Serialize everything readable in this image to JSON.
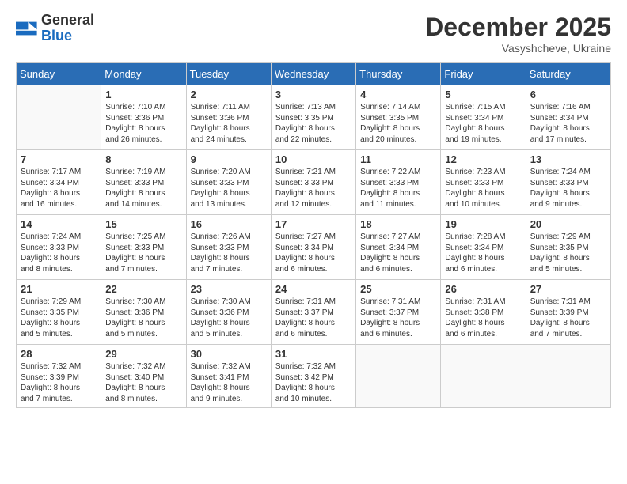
{
  "logo": {
    "general": "General",
    "blue": "Blue"
  },
  "header": {
    "month": "December 2025",
    "location": "Vasyshcheve, Ukraine"
  },
  "weekdays": [
    "Sunday",
    "Monday",
    "Tuesday",
    "Wednesday",
    "Thursday",
    "Friday",
    "Saturday"
  ],
  "weeks": [
    [
      {
        "day": "",
        "lines": []
      },
      {
        "day": "1",
        "lines": [
          "Sunrise: 7:10 AM",
          "Sunset: 3:36 PM",
          "Daylight: 8 hours",
          "and 26 minutes."
        ]
      },
      {
        "day": "2",
        "lines": [
          "Sunrise: 7:11 AM",
          "Sunset: 3:36 PM",
          "Daylight: 8 hours",
          "and 24 minutes."
        ]
      },
      {
        "day": "3",
        "lines": [
          "Sunrise: 7:13 AM",
          "Sunset: 3:35 PM",
          "Daylight: 8 hours",
          "and 22 minutes."
        ]
      },
      {
        "day": "4",
        "lines": [
          "Sunrise: 7:14 AM",
          "Sunset: 3:35 PM",
          "Daylight: 8 hours",
          "and 20 minutes."
        ]
      },
      {
        "day": "5",
        "lines": [
          "Sunrise: 7:15 AM",
          "Sunset: 3:34 PM",
          "Daylight: 8 hours",
          "and 19 minutes."
        ]
      },
      {
        "day": "6",
        "lines": [
          "Sunrise: 7:16 AM",
          "Sunset: 3:34 PM",
          "Daylight: 8 hours",
          "and 17 minutes."
        ]
      }
    ],
    [
      {
        "day": "7",
        "lines": [
          "Sunrise: 7:17 AM",
          "Sunset: 3:34 PM",
          "Daylight: 8 hours",
          "and 16 minutes."
        ]
      },
      {
        "day": "8",
        "lines": [
          "Sunrise: 7:19 AM",
          "Sunset: 3:33 PM",
          "Daylight: 8 hours",
          "and 14 minutes."
        ]
      },
      {
        "day": "9",
        "lines": [
          "Sunrise: 7:20 AM",
          "Sunset: 3:33 PM",
          "Daylight: 8 hours",
          "and 13 minutes."
        ]
      },
      {
        "day": "10",
        "lines": [
          "Sunrise: 7:21 AM",
          "Sunset: 3:33 PM",
          "Daylight: 8 hours",
          "and 12 minutes."
        ]
      },
      {
        "day": "11",
        "lines": [
          "Sunrise: 7:22 AM",
          "Sunset: 3:33 PM",
          "Daylight: 8 hours",
          "and 11 minutes."
        ]
      },
      {
        "day": "12",
        "lines": [
          "Sunrise: 7:23 AM",
          "Sunset: 3:33 PM",
          "Daylight: 8 hours",
          "and 10 minutes."
        ]
      },
      {
        "day": "13",
        "lines": [
          "Sunrise: 7:24 AM",
          "Sunset: 3:33 PM",
          "Daylight: 8 hours",
          "and 9 minutes."
        ]
      }
    ],
    [
      {
        "day": "14",
        "lines": [
          "Sunrise: 7:24 AM",
          "Sunset: 3:33 PM",
          "Daylight: 8 hours",
          "and 8 minutes."
        ]
      },
      {
        "day": "15",
        "lines": [
          "Sunrise: 7:25 AM",
          "Sunset: 3:33 PM",
          "Daylight: 8 hours",
          "and 7 minutes."
        ]
      },
      {
        "day": "16",
        "lines": [
          "Sunrise: 7:26 AM",
          "Sunset: 3:33 PM",
          "Daylight: 8 hours",
          "and 7 minutes."
        ]
      },
      {
        "day": "17",
        "lines": [
          "Sunrise: 7:27 AM",
          "Sunset: 3:34 PM",
          "Daylight: 8 hours",
          "and 6 minutes."
        ]
      },
      {
        "day": "18",
        "lines": [
          "Sunrise: 7:27 AM",
          "Sunset: 3:34 PM",
          "Daylight: 8 hours",
          "and 6 minutes."
        ]
      },
      {
        "day": "19",
        "lines": [
          "Sunrise: 7:28 AM",
          "Sunset: 3:34 PM",
          "Daylight: 8 hours",
          "and 6 minutes."
        ]
      },
      {
        "day": "20",
        "lines": [
          "Sunrise: 7:29 AM",
          "Sunset: 3:35 PM",
          "Daylight: 8 hours",
          "and 5 minutes."
        ]
      }
    ],
    [
      {
        "day": "21",
        "lines": [
          "Sunrise: 7:29 AM",
          "Sunset: 3:35 PM",
          "Daylight: 8 hours",
          "and 5 minutes."
        ]
      },
      {
        "day": "22",
        "lines": [
          "Sunrise: 7:30 AM",
          "Sunset: 3:36 PM",
          "Daylight: 8 hours",
          "and 5 minutes."
        ]
      },
      {
        "day": "23",
        "lines": [
          "Sunrise: 7:30 AM",
          "Sunset: 3:36 PM",
          "Daylight: 8 hours",
          "and 5 minutes."
        ]
      },
      {
        "day": "24",
        "lines": [
          "Sunrise: 7:31 AM",
          "Sunset: 3:37 PM",
          "Daylight: 8 hours",
          "and 6 minutes."
        ]
      },
      {
        "day": "25",
        "lines": [
          "Sunrise: 7:31 AM",
          "Sunset: 3:37 PM",
          "Daylight: 8 hours",
          "and 6 minutes."
        ]
      },
      {
        "day": "26",
        "lines": [
          "Sunrise: 7:31 AM",
          "Sunset: 3:38 PM",
          "Daylight: 8 hours",
          "and 6 minutes."
        ]
      },
      {
        "day": "27",
        "lines": [
          "Sunrise: 7:31 AM",
          "Sunset: 3:39 PM",
          "Daylight: 8 hours",
          "and 7 minutes."
        ]
      }
    ],
    [
      {
        "day": "28",
        "lines": [
          "Sunrise: 7:32 AM",
          "Sunset: 3:39 PM",
          "Daylight: 8 hours",
          "and 7 minutes."
        ]
      },
      {
        "day": "29",
        "lines": [
          "Sunrise: 7:32 AM",
          "Sunset: 3:40 PM",
          "Daylight: 8 hours",
          "and 8 minutes."
        ]
      },
      {
        "day": "30",
        "lines": [
          "Sunrise: 7:32 AM",
          "Sunset: 3:41 PM",
          "Daylight: 8 hours",
          "and 9 minutes."
        ]
      },
      {
        "day": "31",
        "lines": [
          "Sunrise: 7:32 AM",
          "Sunset: 3:42 PM",
          "Daylight: 8 hours",
          "and 10 minutes."
        ]
      },
      {
        "day": "",
        "lines": []
      },
      {
        "day": "",
        "lines": []
      },
      {
        "day": "",
        "lines": []
      }
    ]
  ]
}
